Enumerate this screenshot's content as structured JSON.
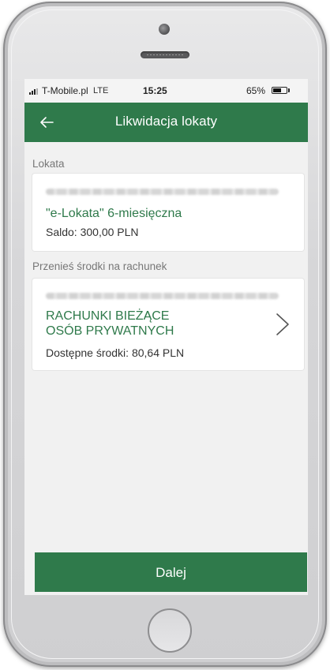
{
  "status_bar": {
    "carrier": "T-Mobile.pl",
    "network": "LTE",
    "time": "15:25",
    "battery_percent": "65%",
    "battery_level": 0.65
  },
  "app_bar": {
    "title": "Likwidacja lokaty",
    "back_icon": "arrow-left-icon"
  },
  "deposit_section": {
    "label": "Lokata",
    "card": {
      "name": "\"e-Lokata\" 6-miesięczna",
      "balance": "Saldo: 300,00 PLN"
    }
  },
  "target_section": {
    "label": "Przenieś środki na rachunek",
    "card": {
      "name": "RACHUNKI BIEŻĄCE OSÓB PRYWATNYCH",
      "name_line1": "RACHUNKI BIEŻĄCE",
      "name_line2": "OSÓB PRYWATNYCH",
      "available": "Dostępne środki: 80,64 PLN",
      "chevron_icon": "chevron-right-icon"
    }
  },
  "actions": {
    "next_label": "Dalej"
  },
  "colors": {
    "brand_green": "#2f7a4b",
    "background": "#f1f1f1"
  }
}
